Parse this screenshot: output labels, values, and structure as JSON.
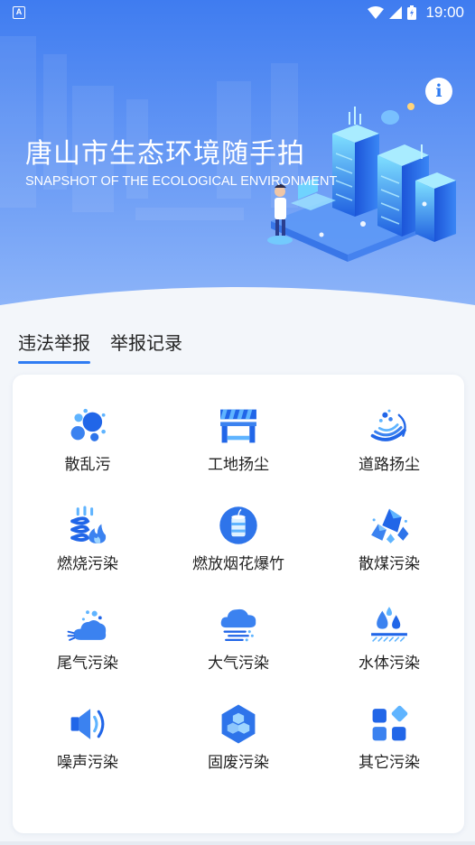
{
  "status_bar": {
    "app_badge": "A",
    "time": "19:00"
  },
  "hero": {
    "title": "唐山市生态环境随手拍",
    "subtitle": "SNAPSHOT OF THE ECOLOGICAL ENVIRONMENT",
    "info_icon": "i"
  },
  "tabs": [
    {
      "label": "违法举报",
      "active": true
    },
    {
      "label": "举报记录",
      "active": false
    }
  ],
  "categories": [
    {
      "label": "散乱污",
      "icon": "scattered-pollution-icon"
    },
    {
      "label": "工地扬尘",
      "icon": "construction-dust-icon"
    },
    {
      "label": "道路扬尘",
      "icon": "road-dust-icon"
    },
    {
      "label": "燃烧污染",
      "icon": "burning-pollution-icon"
    },
    {
      "label": "燃放烟花爆竹",
      "icon": "fireworks-icon"
    },
    {
      "label": "散煤污染",
      "icon": "coal-pollution-icon"
    },
    {
      "label": "尾气污染",
      "icon": "exhaust-pollution-icon"
    },
    {
      "label": "大气污染",
      "icon": "air-pollution-icon"
    },
    {
      "label": "水体污染",
      "icon": "water-pollution-icon"
    },
    {
      "label": "噪声污染",
      "icon": "noise-pollution-icon"
    },
    {
      "label": "固废污染",
      "icon": "solid-waste-icon"
    },
    {
      "label": "其它污染",
      "icon": "other-pollution-icon"
    }
  ],
  "colors": {
    "accent": "#2f7cf2",
    "hero_top": "#3f7df0",
    "hero_bottom": "#8fb6fa",
    "icon_light": "#5fb4ff",
    "icon_dark": "#2166e8"
  }
}
